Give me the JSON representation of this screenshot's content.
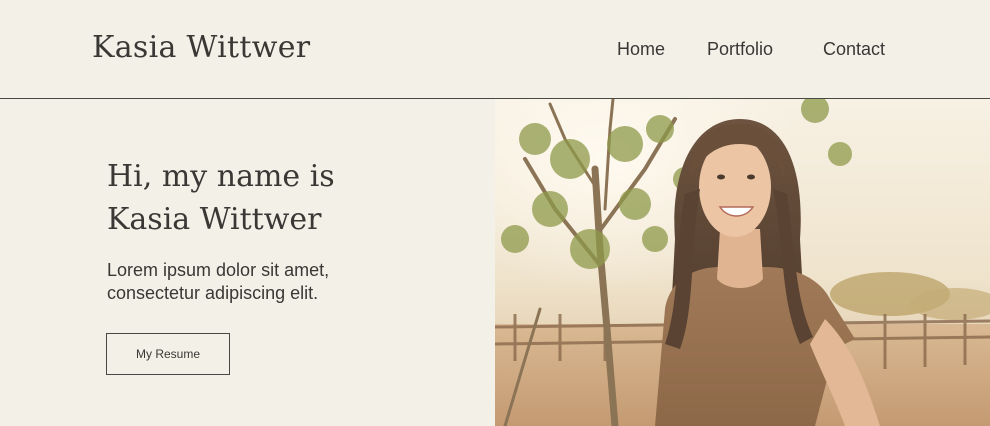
{
  "header": {
    "logo": "Kasia Wittwer",
    "nav": [
      {
        "label": "Home"
      },
      {
        "label": "Portfolio"
      },
      {
        "label": "Contact"
      }
    ]
  },
  "hero": {
    "title_line1": "Hi, my name is",
    "title_line2": "Kasia Wittwer",
    "subtitle_line1": "Lorem ipsum dolor sit amet,",
    "subtitle_line2": "consectetur adipiscing elit.",
    "button_label": "My Resume"
  }
}
